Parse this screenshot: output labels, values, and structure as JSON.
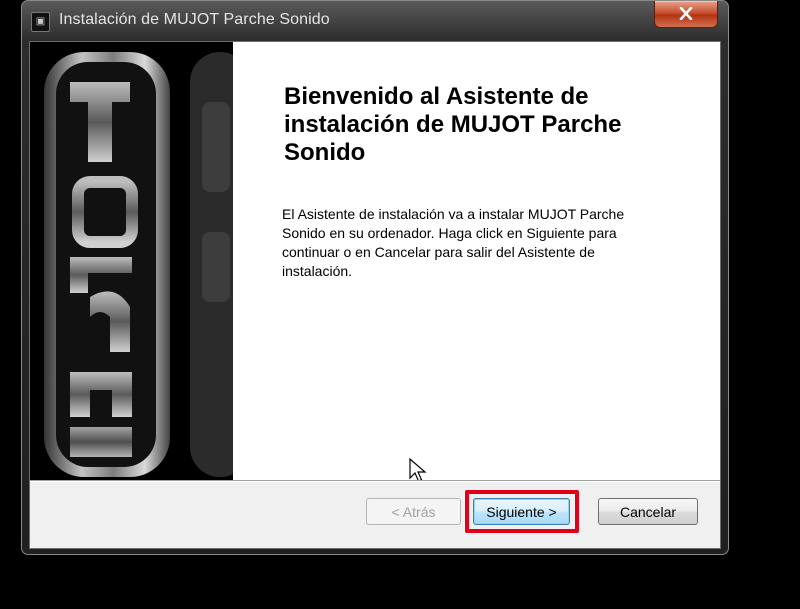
{
  "window": {
    "title": "Instalación de MUJOT Parche Sonido",
    "icon": "app-icon",
    "close_icon": "close-icon"
  },
  "side_panel": {
    "logo_text": "mujot"
  },
  "content": {
    "heading": "Bienvenido al Asistente de instalación de MUJOT Parche Sonido",
    "body": " El Asistente de instalación va a instalar MUJOT Parche\nSonido en su ordenador. Haga click en Siguiente para\ncontinuar o en Cancelar para salir del Asistente de\ninstalación."
  },
  "buttons": {
    "back": "< Atrás",
    "next": "Siguiente >",
    "cancel": "Cancelar"
  },
  "colors": {
    "highlight": "#e0001a"
  }
}
